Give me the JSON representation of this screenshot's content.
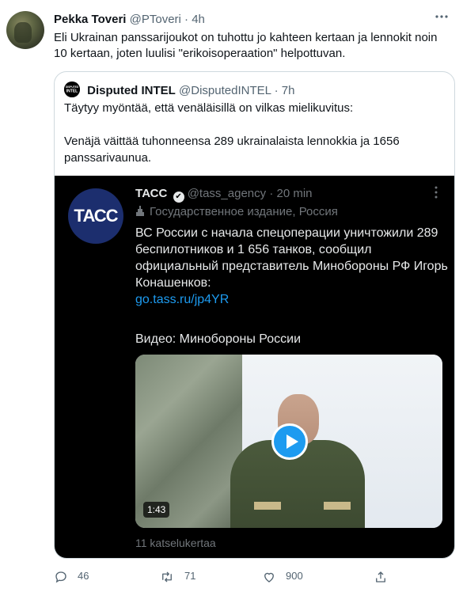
{
  "tweet": {
    "author_name": "Pekka Toveri",
    "author_handle": "@PToveri",
    "separator": "·",
    "time": "4h",
    "text": "Eli Ukrainan panssarijoukot on tuhottu jo kahteen kertaan ja lennokit noin 10 kertaan, joten luulisi \"erikoisoperaation\" helpottuvan."
  },
  "quote": {
    "avatar_text": "DISPUTED INTEL",
    "author_name": "Disputed INTEL",
    "author_handle": "@DisputedINTEL",
    "separator": "·",
    "time": "7h",
    "text_line1": "Täytyy myöntää, että venäläisillä on vilkas mielikuvitus:",
    "text_line2": "Venäjä väittää tuhonneensa 289 ukrainalaista lennokkia ja 1656 panssarivaunua."
  },
  "embedded": {
    "logo_text": "ТАСС",
    "author_name": "ТАСС",
    "verified_mark": "✔",
    "author_handle": "@tass_agency",
    "separator": "·",
    "time": "20 min",
    "label": "Государственное издание, Россия",
    "text": "ВС России с начала спецоперации уничтожили 289 беспилотников и 1 656 танков, сообщил официальный представитель Минобороны РФ Игорь Конашенков:",
    "link": "go.tass.ru/jp4YR",
    "video_caption": "Видео: Минобороны России",
    "video_duration": "1:43",
    "views": "11 katselukertaa"
  },
  "actions": {
    "reply_count": "46",
    "retweet_count": "71",
    "like_count": "900"
  },
  "icons": {
    "more": "more-icon",
    "reply": "reply-icon",
    "retweet": "retweet-icon",
    "like": "like-icon",
    "share": "share-icon",
    "play": "play-icon",
    "state_media": "state-media-icon",
    "verified": "verified-icon"
  },
  "colors": {
    "accent": "#1d9bf0",
    "tass_brand": "#1c2e6e"
  }
}
